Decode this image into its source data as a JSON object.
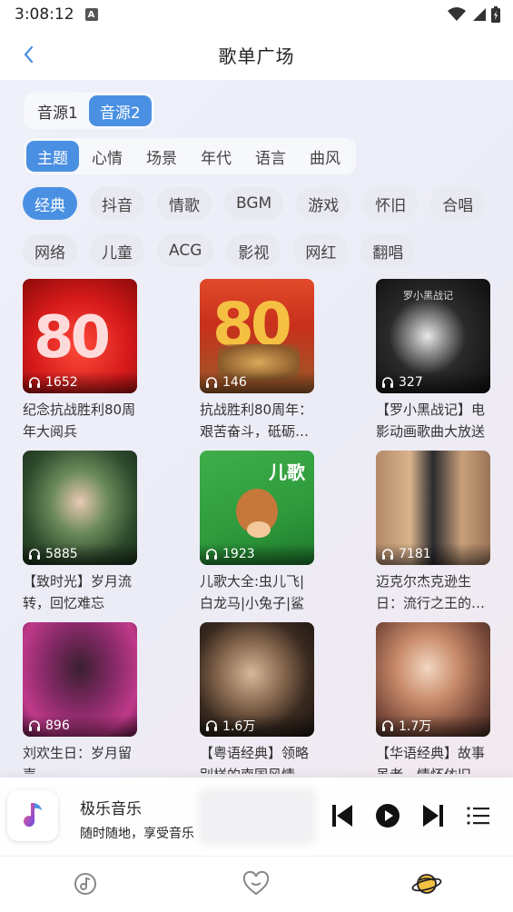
{
  "status_bar": {
    "time": "3:08:12",
    "badge": "A"
  },
  "header": {
    "title": "歌单广场"
  },
  "sources": [
    {
      "label": "音源1",
      "active": false
    },
    {
      "label": "音源2",
      "active": true
    }
  ],
  "categories": [
    {
      "label": "主题",
      "active": true
    },
    {
      "label": "心情",
      "active": false
    },
    {
      "label": "场景",
      "active": false
    },
    {
      "label": "年代",
      "active": false
    },
    {
      "label": "语言",
      "active": false
    },
    {
      "label": "曲风",
      "active": false
    }
  ],
  "tags_row1": [
    "经典",
    "抖音",
    "情歌",
    "BGM",
    "游戏",
    "怀旧",
    "合唱"
  ],
  "tags_row2": [
    "网络",
    "儿童",
    "ACG",
    "影视",
    "网红",
    "翻唱"
  ],
  "active_tag": "经典",
  "playlists": [
    {
      "plays": "1652",
      "title": "纪念抗战胜利80周年大阅兵",
      "cover": "red-80"
    },
    {
      "plays": "146",
      "title": "抗战胜利80周年：艰苦奋斗，砥砺…",
      "cover": "gold-80"
    },
    {
      "plays": "327",
      "title": "【罗小黑战记】电影动画歌曲大放送",
      "cover": "dark-cat"
    },
    {
      "plays": "5885",
      "title": "【致时光】岁月流转，回忆难忘",
      "cover": "green-portrait"
    },
    {
      "plays": "1923",
      "title": "儿歌大全:虫儿飞|白龙马|小兔子|鲨",
      "cover": "kids-monkey"
    },
    {
      "plays": "7181",
      "title": "迈克尔杰克逊生日：流行之王的…",
      "cover": "mj-portrait"
    },
    {
      "plays": "896",
      "title": "刘欢生日：岁月留声",
      "cover": "purple-singer"
    },
    {
      "plays": "1.6万",
      "title": "【粤语经典】领略别样的南国风情",
      "cover": "bw-portrait"
    },
    {
      "plays": "1.7万",
      "title": "【华语经典】故事虽老，情怀依旧",
      "cover": "warm-girl"
    }
  ],
  "player": {
    "name": "极乐音乐",
    "subtitle": "随时随地，享受音乐"
  },
  "colors": {
    "accent": "#4a90e2"
  }
}
